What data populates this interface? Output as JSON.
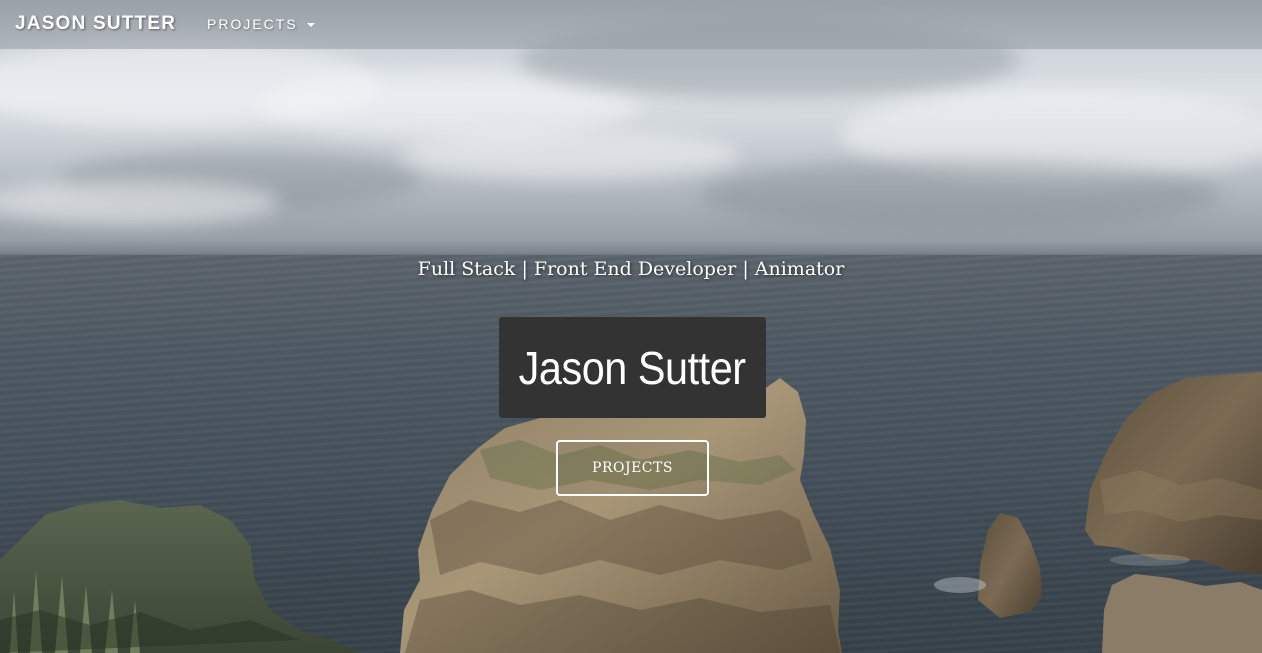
{
  "navbar": {
    "brand": "JASON SUTTER",
    "projects_menu": "PROJECTS"
  },
  "hero": {
    "tagline": "Full Stack | Front End Developer | Animator",
    "title": "Jason Sutter",
    "cta_label": "PROJECTS"
  },
  "background": {
    "scene": "coastal cliffs over the ocean under an overcast sky",
    "colors": {
      "sky": "#cfd5db",
      "sea": "#44505a",
      "rock": "#8a7b62",
      "title_box": "#333333"
    }
  },
  "icons": {
    "menu_caret": "caret-down-icon"
  }
}
